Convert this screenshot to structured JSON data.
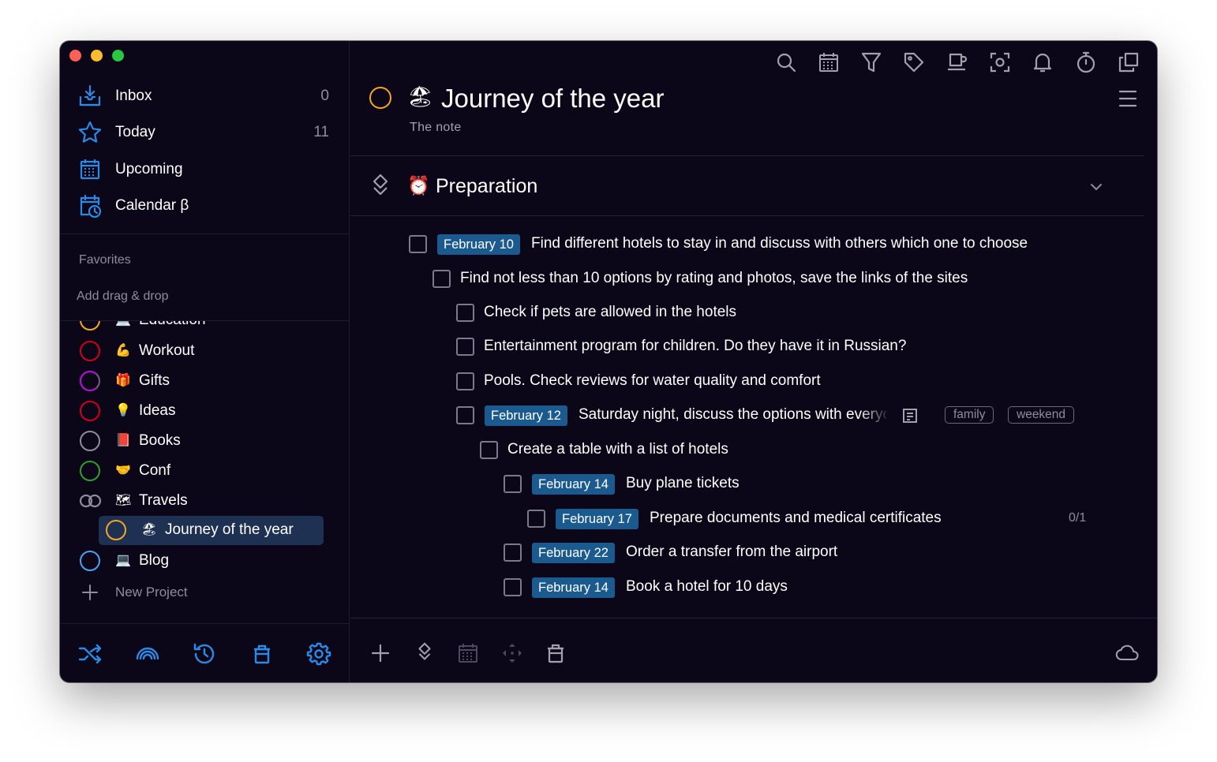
{
  "sidebar": {
    "nav": [
      {
        "label": "Inbox",
        "count": "0",
        "icon": "inbox-tray-icon"
      },
      {
        "label": "Today",
        "count": "11",
        "icon": "star-icon"
      },
      {
        "label": "Upcoming",
        "count": "",
        "icon": "calendar-grid-icon"
      },
      {
        "label": "Calendar β",
        "count": "",
        "icon": "calendar-clock-icon"
      }
    ],
    "favorites_label": "Favorites",
    "drag_hint": "Add drag & drop",
    "projects": [
      {
        "label": "Education",
        "emoji": "💻",
        "ring_color": "#f5a623"
      },
      {
        "label": "Workout",
        "emoji": "💪",
        "ring_color": "#d0021b"
      },
      {
        "label": "Gifts",
        "emoji": "🎁",
        "ring_color": "#bd10e0"
      },
      {
        "label": "Ideas",
        "emoji": "💡",
        "ring_color": "#d0021b"
      },
      {
        "label": "Books",
        "emoji": "📕",
        "ring_color": "#8f8c9b"
      },
      {
        "label": "Conf",
        "emoji": "🤝",
        "ring_color": "#2ea02e"
      },
      {
        "label": "Travels",
        "emoji": "🗺",
        "ring_color": "#8f8c9b"
      },
      {
        "label": "Journey of the year",
        "emoji": "🏖",
        "ring_color": "#f5a623"
      },
      {
        "label": "Blog",
        "emoji": "💻",
        "ring_color": "#4aa3f0"
      }
    ],
    "new_project": "New Project",
    "footer_icons": [
      "shuffle-icon",
      "rainbow-icon",
      "history-icon",
      "trash-icon",
      "settings-gear-icon"
    ]
  },
  "toolbar": {
    "icons": [
      "search-icon",
      "calendar-icon",
      "filter-icon",
      "tag-icon",
      "coffee-cup-icon",
      "focus-icon",
      "bell-icon",
      "stopwatch-icon",
      "copy-icon"
    ]
  },
  "project": {
    "emoji": "🏖",
    "title": "Journey of the year",
    "note": "The note"
  },
  "section": {
    "emoji": "⏰",
    "title": "Preparation"
  },
  "tasks": [
    {
      "date": "February 10",
      "text": "Find different hotels to stay in and discuss with others which one to choose"
    },
    {
      "date": "",
      "text": "Find not less than 10 options by rating and photos, save the links of the sites"
    },
    {
      "date": "",
      "text": "Check if pets are allowed in the hotels"
    },
    {
      "date": "",
      "text": "Entertainment program for children. Do they have it in Russian?"
    },
    {
      "date": "",
      "text": "Pools. Check reviews for water quality and comfort"
    },
    {
      "date": "February 12",
      "text": "Saturday night, discuss the options with everyone",
      "tags": [
        "family",
        "weekend"
      ]
    },
    {
      "date": "",
      "text": "Create a table with a list of hotels"
    },
    {
      "date": "February 14",
      "text": "Buy plane tickets"
    },
    {
      "date": "February 17",
      "text": "Prepare documents and medical certificates",
      "progress": "0/1"
    },
    {
      "date": "February 22",
      "text": "Order a transfer from the airport"
    },
    {
      "date": "February 14",
      "text": "Book a hotel for 10 days"
    }
  ],
  "footer_icons": [
    "add-icon",
    "section-icon",
    "calendar-icon",
    "move-icon",
    "trash-icon",
    "cloud-icon"
  ],
  "colors": {
    "background": "#0b0718",
    "accent": "#1b5a8f",
    "icon_blue": "#2b8ae6"
  }
}
